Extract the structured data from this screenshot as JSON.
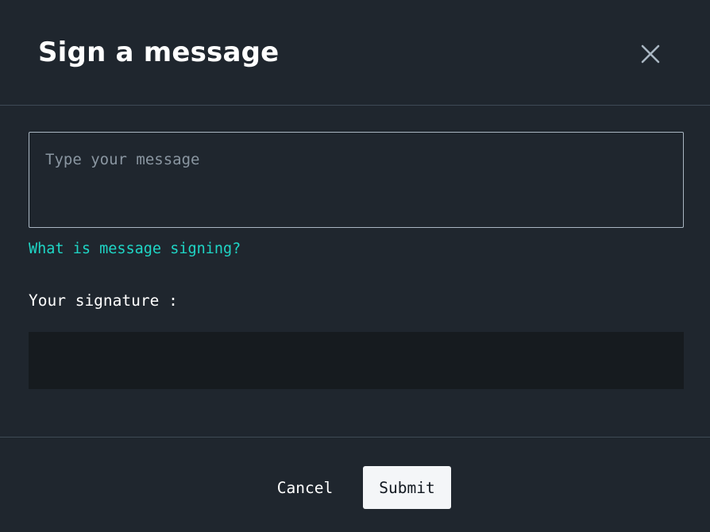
{
  "dialog": {
    "title": "Sign a message",
    "close_icon": "close-icon"
  },
  "message": {
    "value": "",
    "placeholder": "Type your message"
  },
  "help_link": {
    "label": "What is message signing?"
  },
  "signature": {
    "label": "Your signature :",
    "value": ""
  },
  "footer": {
    "cancel_label": "Cancel",
    "submit_label": "Submit"
  },
  "colors": {
    "background": "#1f262e",
    "divider": "#3e4a55",
    "accent_link": "#1fd6c6",
    "signature_bg": "#161b1f",
    "submit_bg": "#f4f6f8"
  }
}
